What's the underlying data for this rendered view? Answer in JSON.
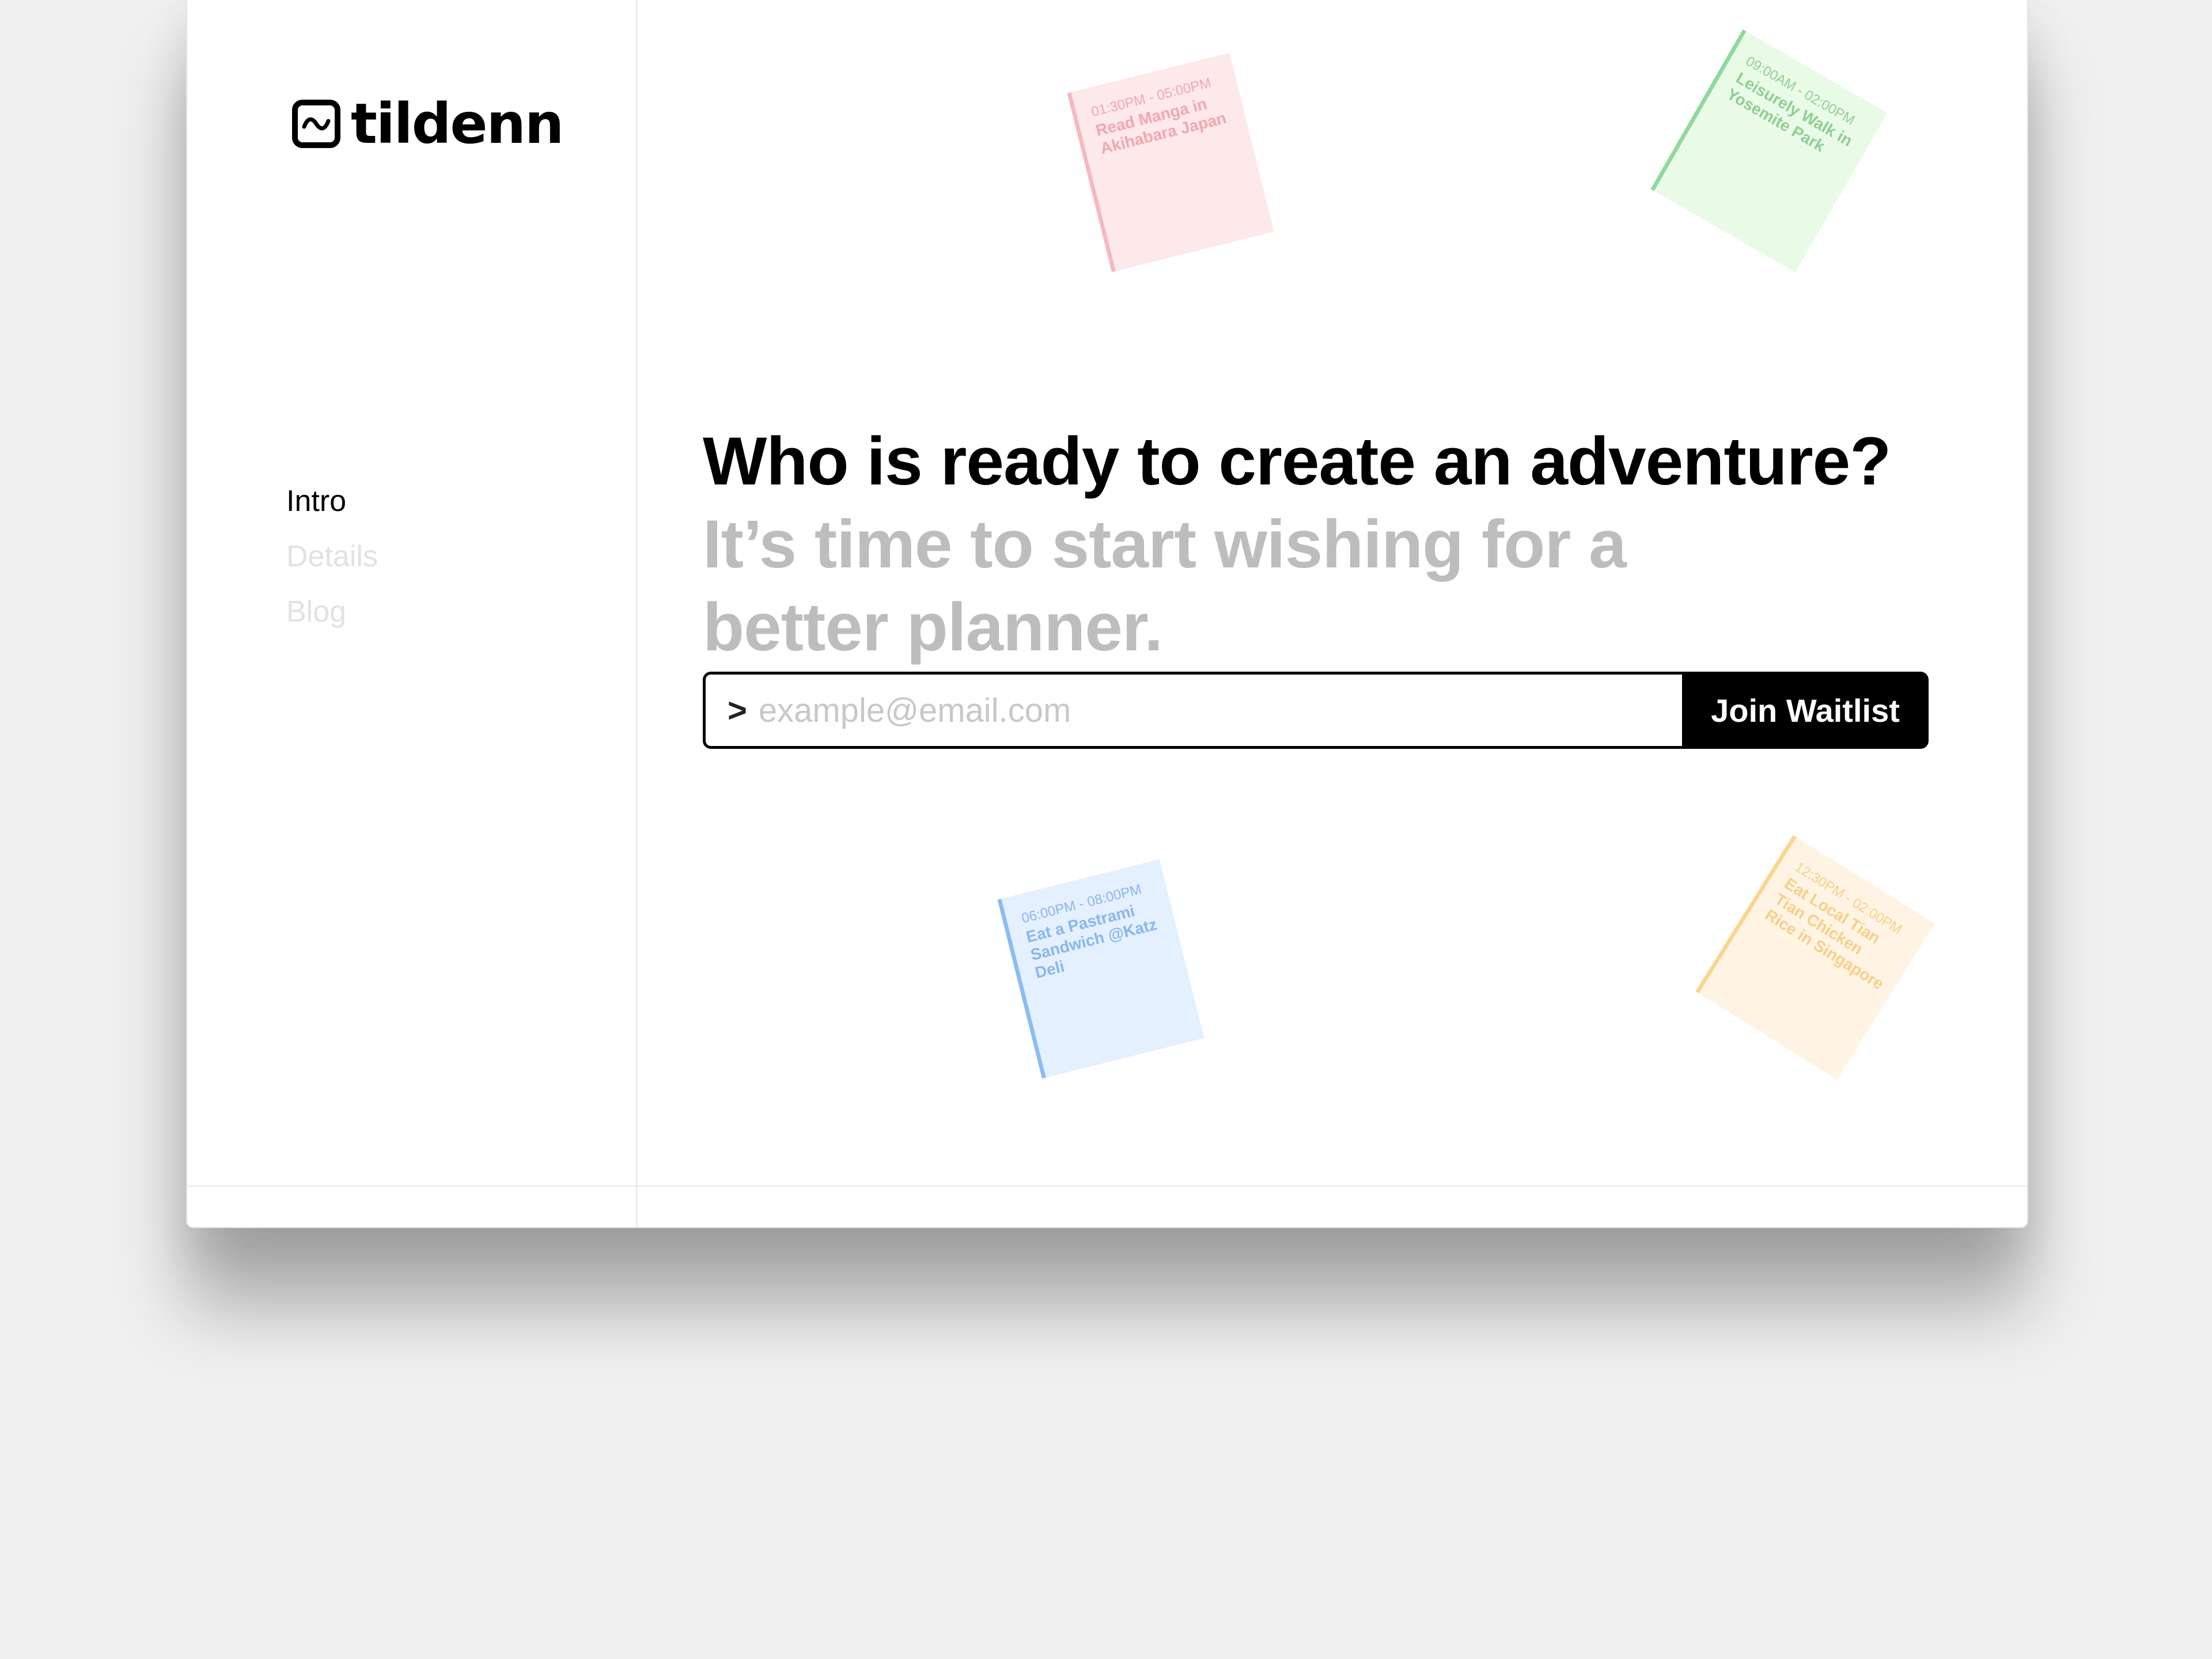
{
  "brand": {
    "name": "tildenn",
    "logo_icon": "tilde-square-icon"
  },
  "nav": {
    "items": [
      {
        "label": "Intro",
        "active": true
      },
      {
        "label": "Details",
        "active": false
      },
      {
        "label": "Blog",
        "active": false
      }
    ]
  },
  "hero": {
    "headline": "Who is ready to create an adventure?",
    "subheadline": "It’s time to start wishing for a better planner."
  },
  "waitlist": {
    "prompt": ">",
    "placeholder": "example@email.com",
    "value": "",
    "button_label": "Join Waitlist"
  },
  "notes": [
    {
      "time": "01:30PM - 05:00PM",
      "title": "Read Manga in Akihabara Japan",
      "color": "#f2a7b0"
    },
    {
      "time": "09:00AM - 02:00PM",
      "title": "Leisurely Walk in Yosemite Park",
      "color": "#8fcf93"
    },
    {
      "time": "06:00PM - 08:00PM",
      "title": "Eat a Pastrami Sandwich @Katz Deli",
      "color": "#8ab7ee"
    },
    {
      "time": "12:30PM - 02:00PM",
      "title": "Eat Local Tian Tian Chicken Rice in Singapore",
      "color": "#f7cf8a"
    }
  ],
  "colors": {
    "accent": "#000000",
    "muted_text": "#bdbdbd",
    "background": "#ffffff"
  }
}
